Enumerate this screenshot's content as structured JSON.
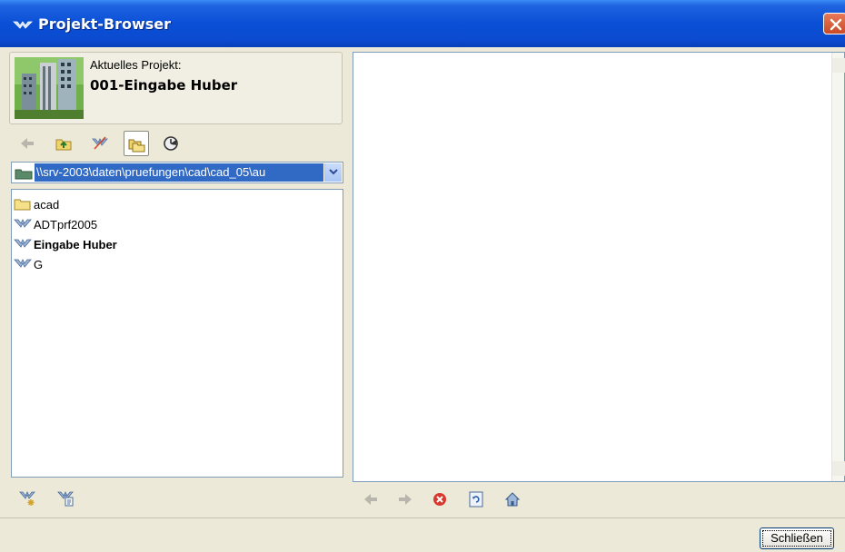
{
  "window": {
    "title": "Projekt-Browser"
  },
  "project": {
    "label": "Aktuelles Projekt:",
    "name": "001-Eingabe Huber"
  },
  "path": {
    "value": "\\\\srv-2003\\daten\\pruefungen\\cad\\cad_05\\au"
  },
  "tree": {
    "items": [
      {
        "label": "acad",
        "icon": "folder-icon",
        "bold": false
      },
      {
        "label": "ADTprf2005",
        "icon": "project-icon",
        "bold": false
      },
      {
        "label": "Eingabe Huber",
        "icon": "project-icon",
        "bold": true
      },
      {
        "label": "G",
        "icon": "project-icon",
        "bold": false
      }
    ]
  },
  "footer": {
    "close_label": "Schließen"
  },
  "colors": {
    "titlebar": "#0a4fd6",
    "selection": "#316ac5",
    "close": "#d9582d"
  }
}
